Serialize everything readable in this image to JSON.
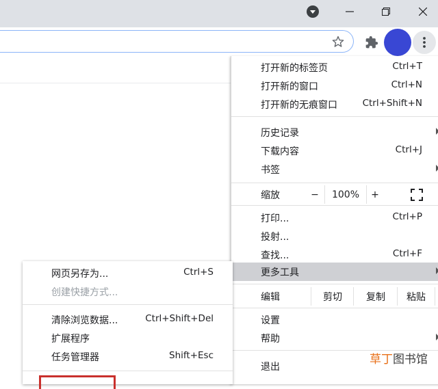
{
  "menu": {
    "new_tab": {
      "label": "打开新的标签页",
      "shortcut": "Ctrl+T"
    },
    "new_window": {
      "label": "打开新的窗口",
      "shortcut": "Ctrl+N"
    },
    "incognito": {
      "label": "打开新的无痕窗口",
      "shortcut": "Ctrl+Shift+N"
    },
    "history": {
      "label": "历史记录"
    },
    "downloads": {
      "label": "下载内容",
      "shortcut": "Ctrl+J"
    },
    "bookmarks": {
      "label": "书签"
    },
    "zoom": {
      "label": "缩放",
      "minus": "−",
      "value": "100%",
      "plus": "+"
    },
    "print": {
      "label": "打印...",
      "shortcut": "Ctrl+P"
    },
    "cast": {
      "label": "投射..."
    },
    "find": {
      "label": "查找...",
      "shortcut": "Ctrl+F"
    },
    "more_tools": {
      "label": "更多工具"
    },
    "edit": {
      "label": "编辑",
      "cut": "剪切",
      "copy": "复制",
      "paste": "粘贴"
    },
    "settings": {
      "label": "设置"
    },
    "help": {
      "label": "帮助"
    },
    "exit": {
      "label": "退出"
    }
  },
  "submenu": {
    "save_page": {
      "label": "网页另存为...",
      "shortcut": "Ctrl+S"
    },
    "create_shortcut": {
      "label": "创建快捷方式..."
    },
    "clear_data": {
      "label": "清除浏览数据...",
      "shortcut": "Ctrl+Shift+Del"
    },
    "extensions": {
      "label": "扩展程序"
    },
    "task_manager": {
      "label": "任务管理器",
      "shortcut": "Shift+Esc"
    }
  },
  "watermark": {
    "part1": "草丁",
    "part2": "图书馆"
  },
  "colors": {
    "avatar": "#3947d4",
    "highlight": "#cfd0d4",
    "titlebar": "#dee1e6",
    "omnibox_border": "#8ab4f8"
  },
  "icons": [
    "tab-search-icon",
    "minimize-icon",
    "restore-icon",
    "close-icon",
    "star-icon",
    "extensions-icon",
    "more-vert-icon",
    "fullscreen-icon",
    "submenu-arrow-icon"
  ]
}
